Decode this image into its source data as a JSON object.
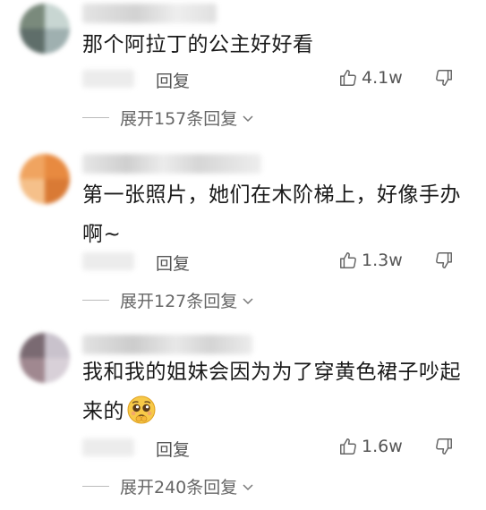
{
  "comments": [
    {
      "text": "那个阿拉丁的公主好好看",
      "reply_label": "回复",
      "likes": "4.1w",
      "expand_label": "展开157条回复",
      "avatar_colors": [
        "#7a8a7c",
        "#c8d6d2",
        "#5f6e6a",
        "#9fb0b0"
      ]
    },
    {
      "text": "第一张照片，她们在木阶梯上，好像手办啊~",
      "reply_label": "回复",
      "likes": "1.3w",
      "expand_label": "展开127条回复",
      "avatar_colors": [
        "#f0a460",
        "#e88a40",
        "#f5c08a",
        "#d97a35"
      ]
    },
    {
      "text": "我和我的姐妹会因为为了穿黄色裙子吵起来的",
      "reply_label": "回复",
      "likes": "1.6w",
      "expand_label": "展开240条回复",
      "avatar_colors": [
        "#7a6a72",
        "#c9c2cc",
        "#a08890",
        "#d8d0d8"
      ]
    }
  ]
}
